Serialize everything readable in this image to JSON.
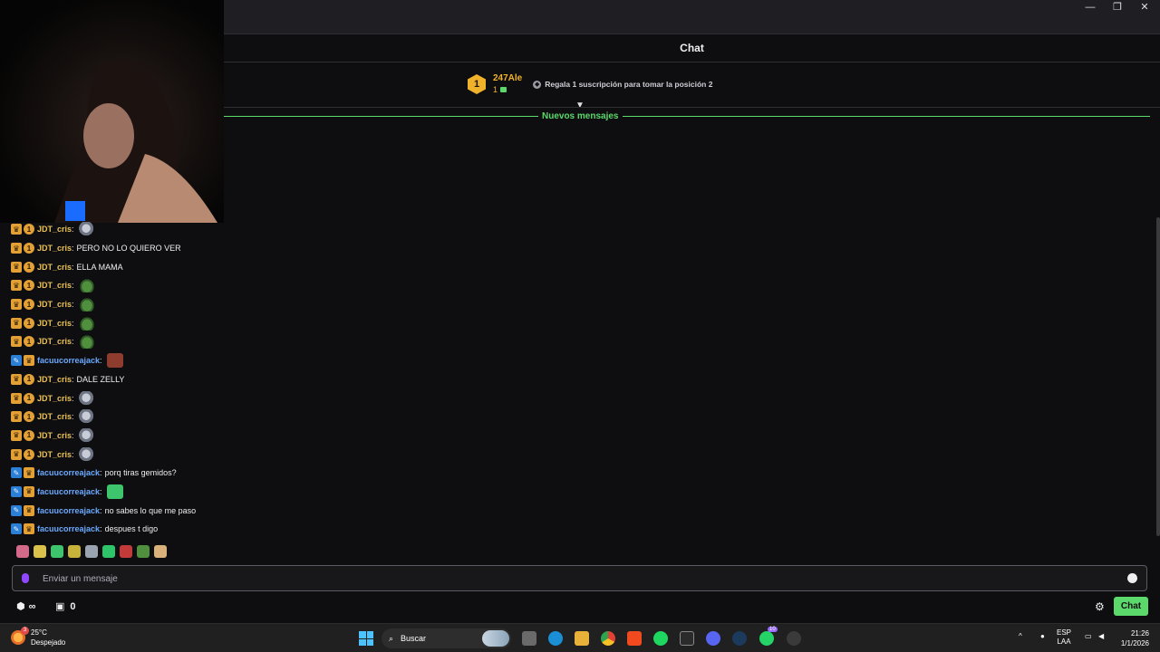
{
  "window": {
    "minimize_label": "—",
    "maximize_label": "❐",
    "close_label": "✕"
  },
  "chat_header": {
    "title": "Chat"
  },
  "leaderboard": {
    "rank": "1",
    "username": "247Ale",
    "count": "1",
    "gift_message": "Regala 1 suscripción para tomar la posición 2"
  },
  "new_messages_label": "Nuevos mensajes",
  "messages": [
    {
      "user": "JDT_cris",
      "text": "",
      "emote": "rat",
      "badges": [
        "crown",
        "coin"
      ],
      "color": "yellow"
    },
    {
      "user": "JDT_cris",
      "text": "PERO NO LO QUIERO VER",
      "emote": "",
      "badges": [
        "crown",
        "coin"
      ],
      "color": "yellow"
    },
    {
      "user": "JDT_cris",
      "text": "ELLA MAMA",
      "emote": "",
      "badges": [
        "crown",
        "coin"
      ],
      "color": "yellow"
    },
    {
      "user": "JDT_cris",
      "text": "",
      "emote": "frog",
      "badges": [
        "crown",
        "coin"
      ],
      "color": "yellow"
    },
    {
      "user": "JDT_cris",
      "text": "",
      "emote": "frog",
      "badges": [
        "crown",
        "coin"
      ],
      "color": "yellow"
    },
    {
      "user": "JDT_cris",
      "text": "",
      "emote": "frog",
      "badges": [
        "crown",
        "coin"
      ],
      "color": "yellow"
    },
    {
      "user": "JDT_cris",
      "text": "",
      "emote": "frog",
      "badges": [
        "crown",
        "coin"
      ],
      "color": "yellow"
    },
    {
      "user": "facuucorreajack",
      "text": "",
      "emote": "face",
      "badges": [
        "tool",
        "crown"
      ],
      "color": "blue"
    },
    {
      "user": "JDT_cris",
      "text": "DALE ZELLY",
      "emote": "",
      "badges": [
        "crown",
        "coin"
      ],
      "color": "yellow"
    },
    {
      "user": "JDT_cris",
      "text": "",
      "emote": "rat",
      "badges": [
        "crown",
        "coin"
      ],
      "color": "yellow"
    },
    {
      "user": "JDT_cris",
      "text": "",
      "emote": "rat",
      "badges": [
        "crown",
        "coin"
      ],
      "color": "yellow"
    },
    {
      "user": "JDT_cris",
      "text": "",
      "emote": "rat",
      "badges": [
        "crown",
        "coin"
      ],
      "color": "yellow"
    },
    {
      "user": "JDT_cris",
      "text": "",
      "emote": "rat",
      "badges": [
        "crown",
        "coin"
      ],
      "color": "yellow"
    },
    {
      "user": "facuucorreajack",
      "text": "porq tiras gemidos?",
      "emote": "",
      "badges": [
        "tool",
        "crown"
      ],
      "color": "blue"
    },
    {
      "user": "facuucorreajack",
      "text": "",
      "emote": "green",
      "badges": [
        "tool",
        "crown"
      ],
      "color": "blue"
    },
    {
      "user": "facuucorreajack",
      "text": "no sabes lo que me paso",
      "emote": "",
      "badges": [
        "tool",
        "crown"
      ],
      "color": "blue"
    },
    {
      "user": "facuucorreajack",
      "text": "despues t digo",
      "emote": "",
      "badges": [
        "tool",
        "crown"
      ],
      "color": "blue"
    }
  ],
  "input": {
    "placeholder": "Enviar un mensaje"
  },
  "bottom_bar": {
    "bits_label": "∞",
    "points_value": "0",
    "chat_button": "Chat"
  },
  "taskbar": {
    "temperature": "25°C",
    "weather_text": "Despejado",
    "weather_badge": "3",
    "search_label": "Buscar",
    "whatsapp_badge": "10",
    "lang_1": "ESP",
    "lang_2": "LAA",
    "time": "21:26",
    "date": "1/1/2026"
  },
  "colors": {
    "accent_green": "#5bd96a",
    "user_yellow": "#eac05b",
    "user_blue": "#6aa9ff",
    "medal_gold": "#f0b22a"
  }
}
